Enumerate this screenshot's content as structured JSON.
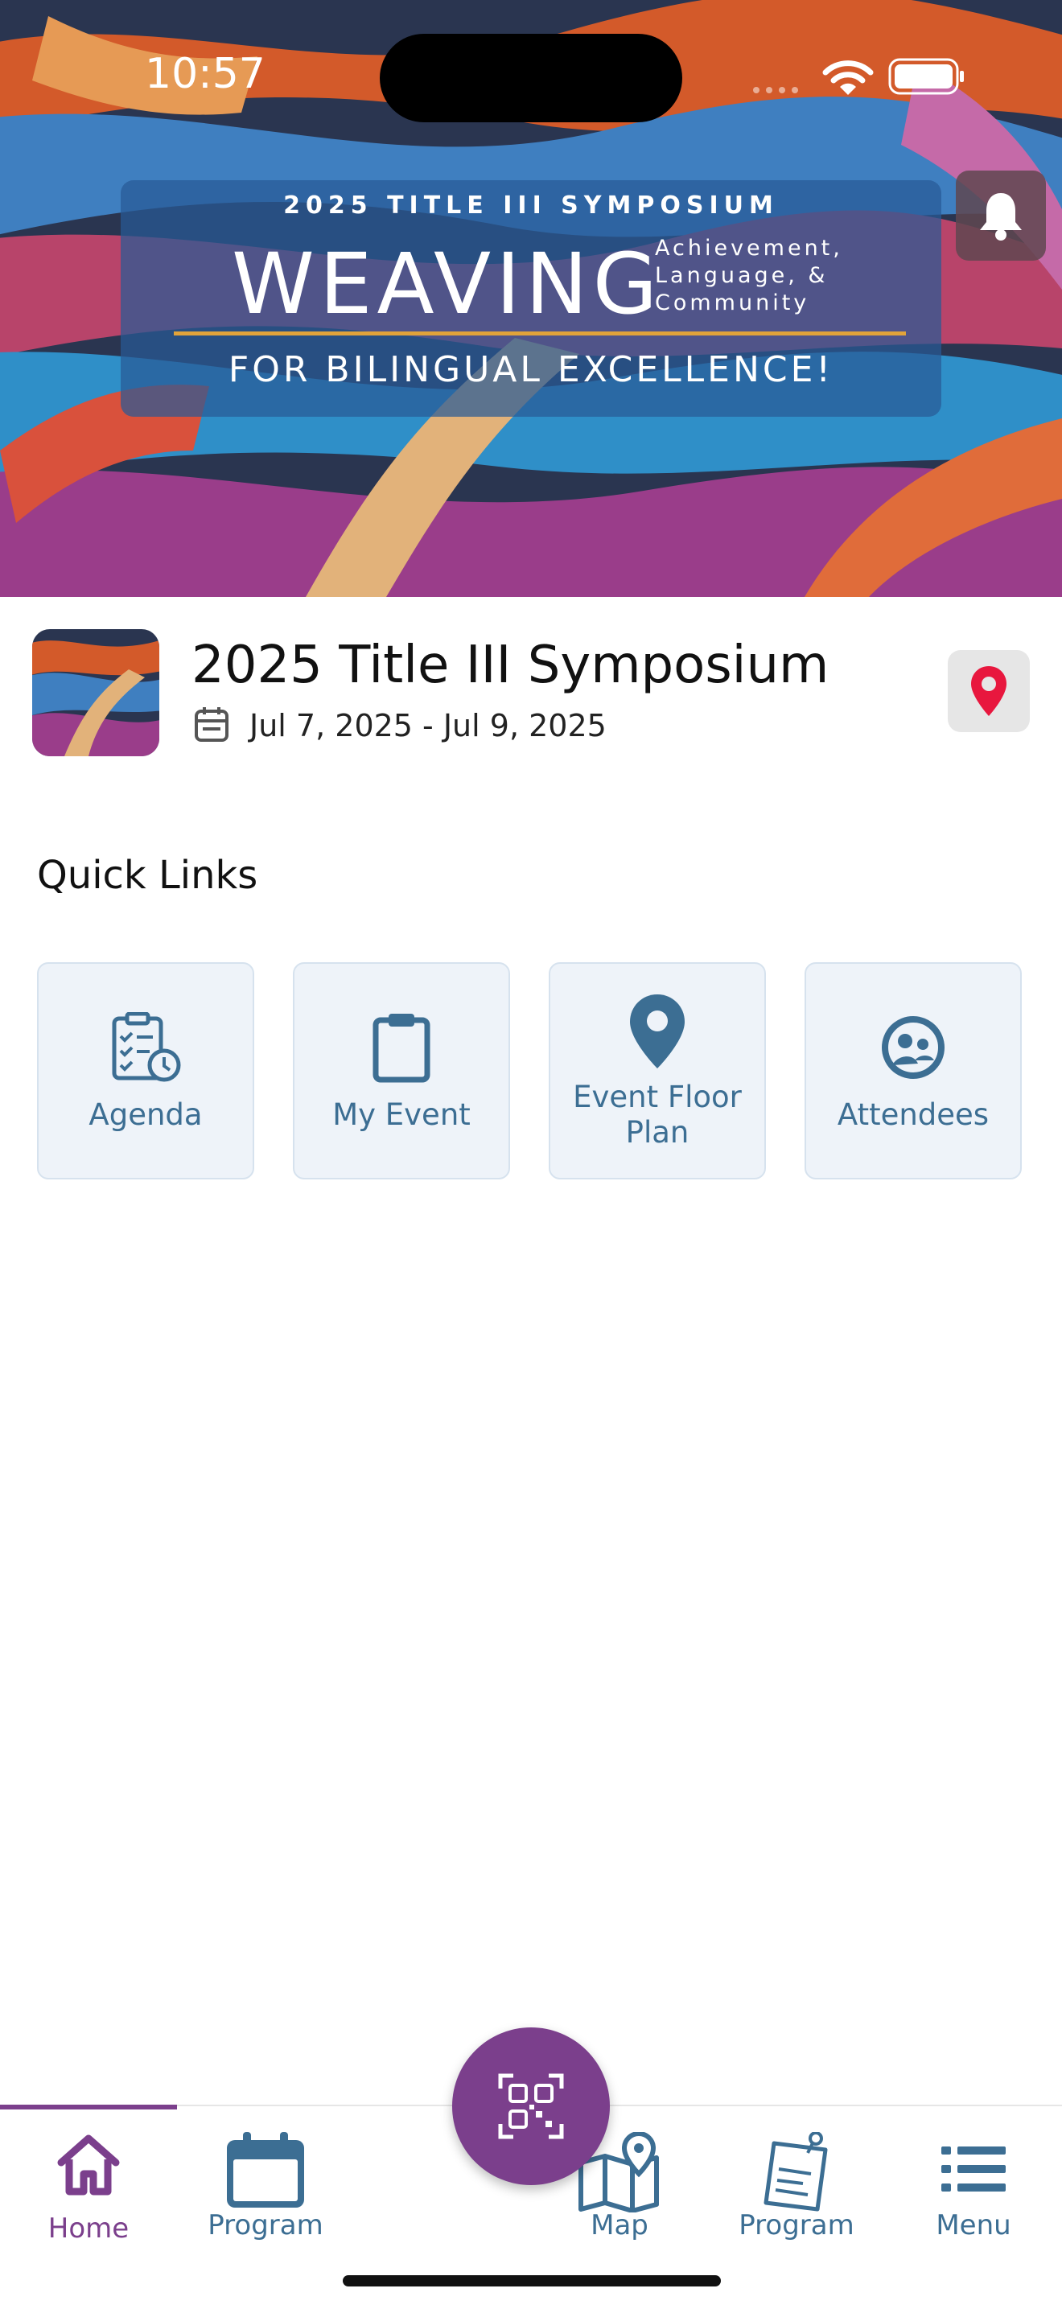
{
  "status_bar": {
    "time": "10:57"
  },
  "banner": {
    "supertitle": "2025 TITLE III SYMPOSIUM",
    "main_word": "WEAVING",
    "side_lines": [
      "Achievement,",
      "Language, &",
      "Community"
    ],
    "subtitle": "FOR BILINGUAL EXCELLENCE!"
  },
  "event": {
    "title": "2025 Title III Symposium",
    "dates": "Jul 7, 2025 - Jul 9, 2025"
  },
  "quick_links": {
    "heading": "Quick Links",
    "items": [
      {
        "label": "Agenda",
        "icon": "agenda-clipboard-clock-icon"
      },
      {
        "label": "My Event",
        "icon": "clipboard-icon"
      },
      {
        "label": "Event Floor Plan",
        "icon": "map-pin-icon"
      },
      {
        "label": "Attendees",
        "icon": "attendees-icon"
      }
    ]
  },
  "tab_bar": {
    "items": [
      {
        "label": "Home",
        "icon": "home-icon",
        "active": true
      },
      {
        "label": "Program",
        "icon": "calendar-icon",
        "active": false
      },
      {
        "label": "Map",
        "icon": "map-icon",
        "active": false
      },
      {
        "label": "Program",
        "icon": "notepad-icon",
        "active": false
      },
      {
        "label": "Menu",
        "icon": "menu-list-icon",
        "active": false
      }
    ],
    "center_button_icon": "qr-code-icon"
  },
  "colors": {
    "accent_purple": "#7b3f8c",
    "link_blue": "#3c6e93",
    "pin_red": "#e8173e",
    "tile_bg": "#eef3f9"
  }
}
